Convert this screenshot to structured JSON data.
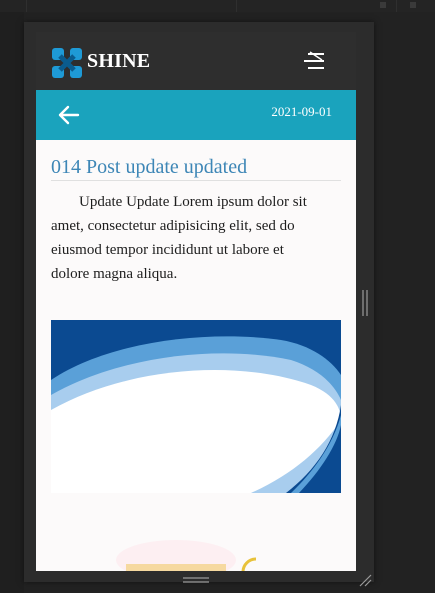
{
  "header": {
    "brand": "SHINE",
    "icons": {
      "logo": "shine-logo-icon",
      "menu": "hamburger-menu-icon"
    }
  },
  "subbar": {
    "date": "2021-09-01",
    "back_icon": "arrow-left-icon"
  },
  "post": {
    "title": "014 Post update updated",
    "body": "Update Update Lorem ipsum dolor sit amet, consectetur adipisicing elit, sed do eiusmod tempor incididunt ut labore et dolore magna aliqua."
  },
  "colors": {
    "header_bg": "#2e2e2e",
    "accent_bar": "#1aa3bd",
    "title": "#3d86b6",
    "logo": "#1e9ad6",
    "banner_blue": "#0b4a91"
  }
}
